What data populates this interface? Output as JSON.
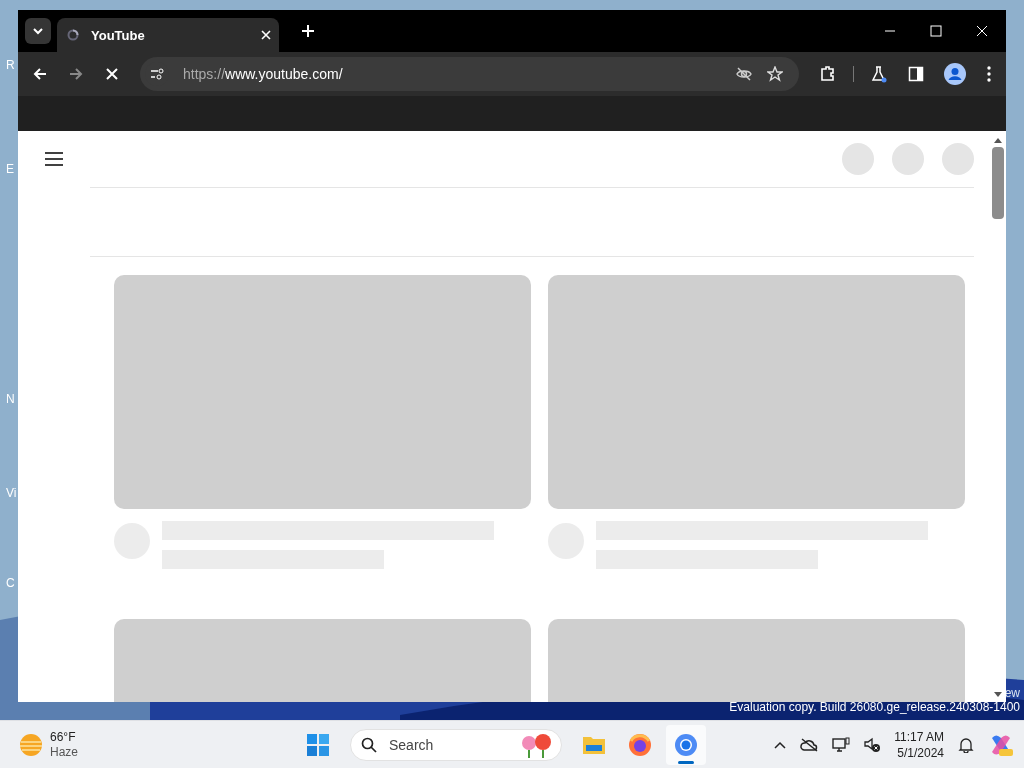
{
  "desktop": {
    "icon_labels": [
      "R",
      "E",
      "N",
      "Vi",
      "C"
    ],
    "watermark": [
      "ew",
      "Evaluation copy. Build 26080.ge_release.240308-1400"
    ]
  },
  "browser": {
    "tabs": [
      {
        "title": "YouTube",
        "selected": true,
        "loading": true
      }
    ],
    "address": {
      "scheme": "https://",
      "host": "www.youtube.com/"
    },
    "page": {
      "loading": true
    }
  },
  "taskbar": {
    "weather": {
      "temperature": "66°F",
      "condition": "Haze"
    },
    "search": {
      "placeholder": "Search"
    },
    "apps": [
      {
        "kind": "start",
        "selected": false
      },
      {
        "kind": "files",
        "selected": false
      },
      {
        "kind": "firefox",
        "selected": false
      },
      {
        "kind": "chrome",
        "selected": true
      }
    ],
    "clock": {
      "time": "11:17 AM",
      "date": "5/1/2024"
    }
  }
}
